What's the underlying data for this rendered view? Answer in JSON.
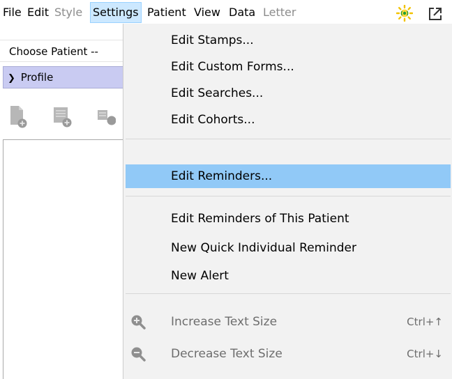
{
  "menubar": {
    "items": [
      {
        "label": "File",
        "state": "normal"
      },
      {
        "label": "Edit",
        "state": "normal"
      },
      {
        "label": "Style",
        "state": "disabled"
      },
      {
        "label": "Settings",
        "state": "active"
      },
      {
        "label": "Patient",
        "state": "normal"
      },
      {
        "label": "View",
        "state": "normal"
      },
      {
        "label": "Data",
        "state": "normal"
      },
      {
        "label": "Letter",
        "state": "disabled"
      }
    ],
    "icons": [
      "sun-status-icon",
      "external-window-icon"
    ]
  },
  "app": {
    "choose_patient": "Choose Patient --",
    "profile_label": "Profile",
    "toolbar_icons": [
      "new-document-icon",
      "new-form-icon",
      "new-record-icon"
    ]
  },
  "settings_menu": {
    "items": [
      {
        "label": "Edit Stamps...",
        "state": "normal"
      },
      {
        "label": "Edit Custom Forms...",
        "state": "normal"
      },
      {
        "label": "Edit Searches...",
        "state": "normal"
      },
      {
        "label": "Edit Cohorts...",
        "state": "normal"
      },
      {
        "label": "Edit Reminders...",
        "state": "highlighted"
      },
      {
        "label": "Edit Reminders of This Patient",
        "state": "normal"
      },
      {
        "label": "New Quick Individual Reminder",
        "state": "normal"
      },
      {
        "label": "New Alert",
        "state": "normal"
      },
      {
        "label": "Increase Text Size",
        "shortcut": "Ctrl+↑",
        "icon": "zoom-in-icon",
        "state": "disabled"
      },
      {
        "label": "Decrease Text Size",
        "shortcut": "Ctrl+↓",
        "icon": "zoom-out-icon",
        "state": "disabled"
      }
    ]
  },
  "colors": {
    "active_menu_bg": "#cce8ff",
    "highlight_bg": "#91c9f7",
    "profile_bg": "#c9cbf2",
    "disabled_text": "#8c8c8c"
  }
}
